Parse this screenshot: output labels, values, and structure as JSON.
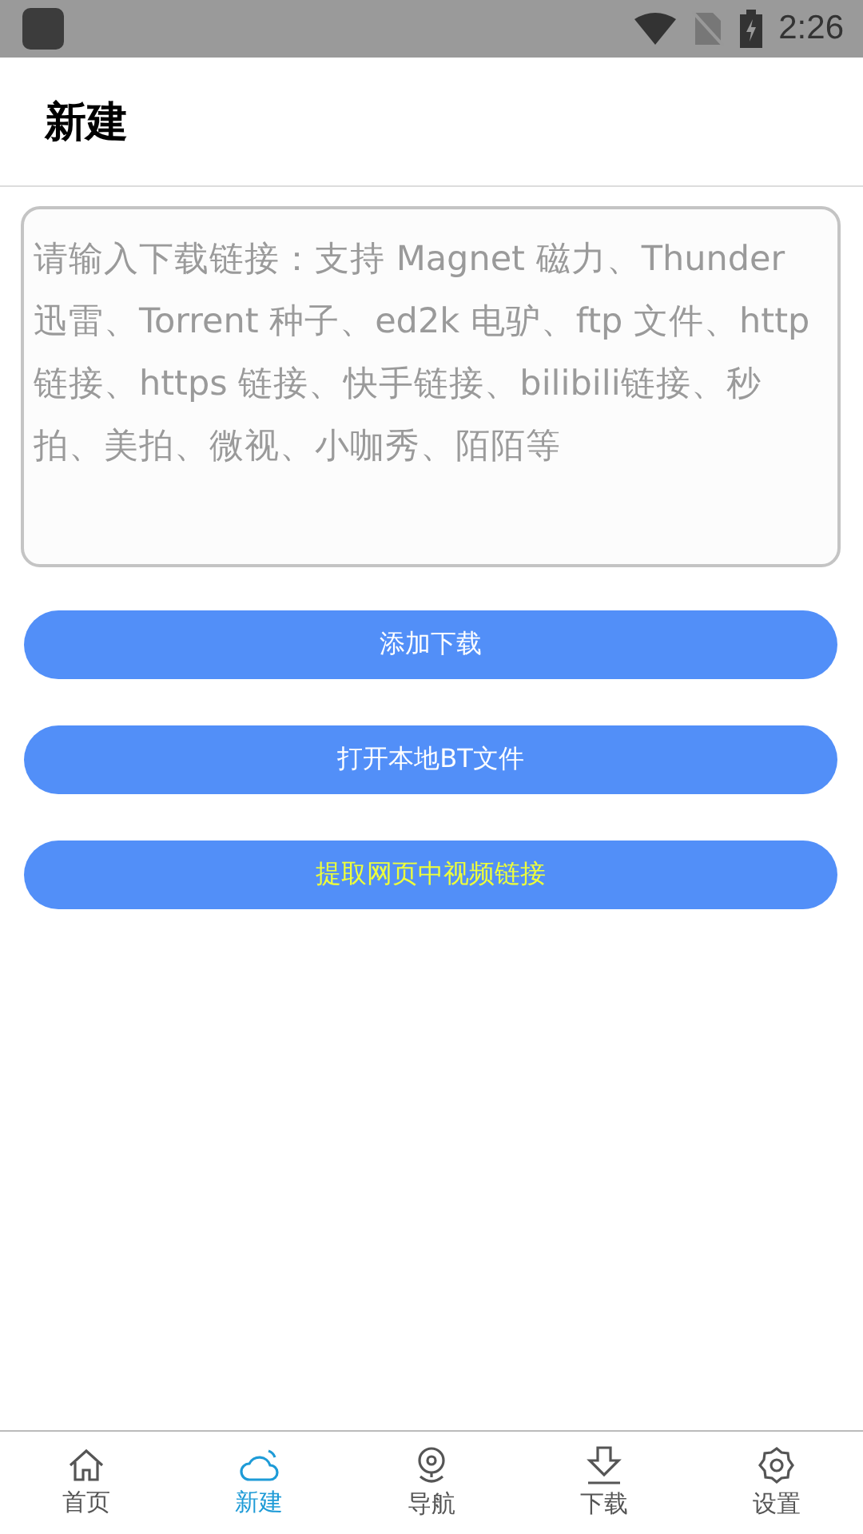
{
  "status_bar": {
    "time": "2:26"
  },
  "header": {
    "title": "新建"
  },
  "link_input": {
    "placeholder": "请输入下载链接：支持 Magnet 磁力、Thunder 迅雷、Torrent 种子、ed2k 电驴、ftp 文件、http 链接、https 链接、快手链接、bilibili链接、秒拍、美拍、微视、小咖秀、陌陌等"
  },
  "buttons": [
    {
      "label": "添加下载",
      "highlight": false
    },
    {
      "label": "打开本地BT文件",
      "highlight": false
    },
    {
      "label": "提取网页中视频链接",
      "highlight": true
    }
  ],
  "tabs": [
    {
      "label": "首页",
      "kind": "home",
      "selected": false
    },
    {
      "label": "新建",
      "kind": "cloud",
      "selected": true
    },
    {
      "label": "导航",
      "kind": "pin",
      "selected": false
    },
    {
      "label": "下载",
      "kind": "download",
      "selected": false
    },
    {
      "label": "设置",
      "kind": "gear",
      "selected": false
    }
  ]
}
